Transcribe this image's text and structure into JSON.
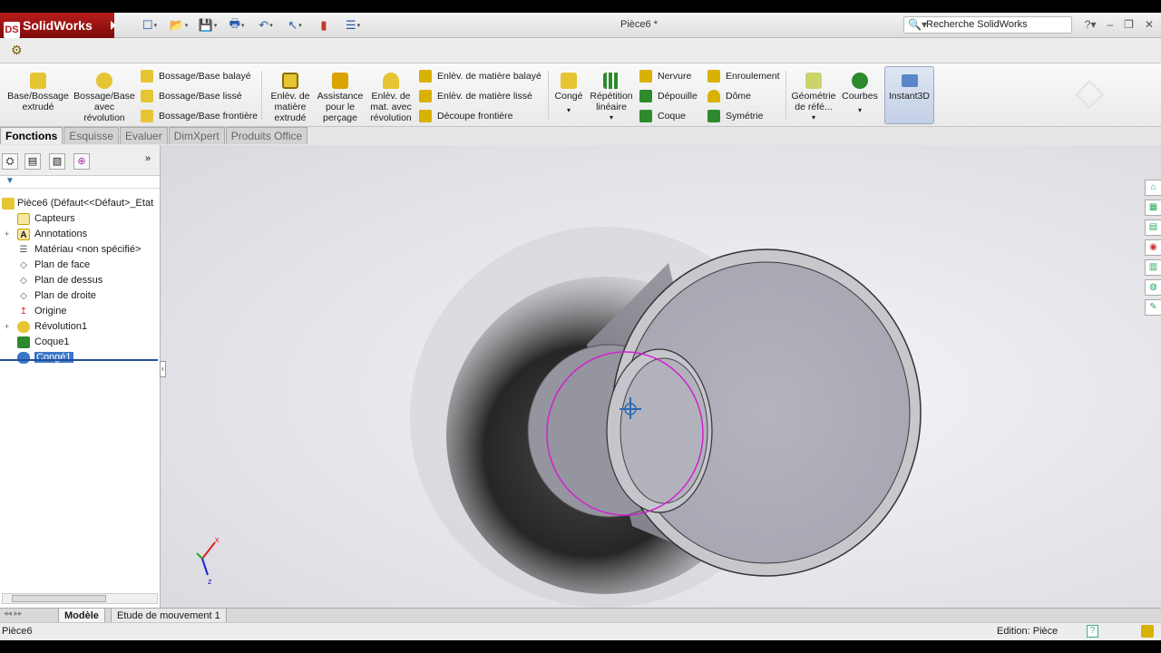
{
  "window": {
    "app_name": "SolidWorks",
    "document_title": "Pièce6 *",
    "search_placeholder": "Recherche SolidWorks"
  },
  "ribbon": {
    "big_buttons": [
      {
        "label": "Base/Bossage\nextrudé"
      },
      {
        "label": "Bossage/Base\navec\nrévolution"
      },
      {
        "label": "Enlèv. de\nmatière\nextrudé"
      },
      {
        "label": "Assistance\npour le\nperçage"
      },
      {
        "label": "Enlèv. de\nmat. avec\nrévolution"
      },
      {
        "label": "Congé"
      },
      {
        "label": "Répétition\nlinéaire"
      },
      {
        "label": "Géométrie\nde réfé..."
      },
      {
        "label": "Courbes"
      }
    ],
    "small_buttons": {
      "bossage_balaye": "Bossage/Base balayé",
      "bossage_lisse": "Bossage/Base lissé",
      "bossage_frontiere": "Bossage/Base frontière",
      "enlev_balaye": "Enlèv. de matière balayé",
      "enlev_lisse": "Enlèv. de matière lissé",
      "decoupe_frontiere": "Découpe frontière",
      "nervure": "Nervure",
      "depouille": "Dépouille",
      "coque": "Coque",
      "enroulement": "Enroulement",
      "dome": "Dôme",
      "symetrie": "Symétrie"
    },
    "instant3d": "Instant3D"
  },
  "tabs": [
    "Fonctions",
    "Esquisse",
    "Evaluer",
    "DimXpert",
    "Produits Office"
  ],
  "tree": {
    "root": "Pièce6  (Défaut<<Défaut>_Etat",
    "items": [
      {
        "label": "Capteurs"
      },
      {
        "label": "Annotations"
      },
      {
        "label": "Matériau <non spécifié>"
      },
      {
        "label": "Plan de face"
      },
      {
        "label": "Plan de dessus"
      },
      {
        "label": "Plan de droite"
      },
      {
        "label": "Origine"
      },
      {
        "label": "Révolution1"
      },
      {
        "label": "Coque1"
      },
      {
        "label": "Congé1"
      }
    ]
  },
  "triad": {
    "x": "x",
    "z": "z"
  },
  "bottom_tabs": [
    "Modèle",
    "Etude de mouvement 1"
  ],
  "status": {
    "left": "Pièce6",
    "right": "Edition: Pièce"
  },
  "colors": {
    "brand_red": "#b81d1d",
    "selection": "#3b77c9",
    "preview_edge": "#d020d0"
  }
}
